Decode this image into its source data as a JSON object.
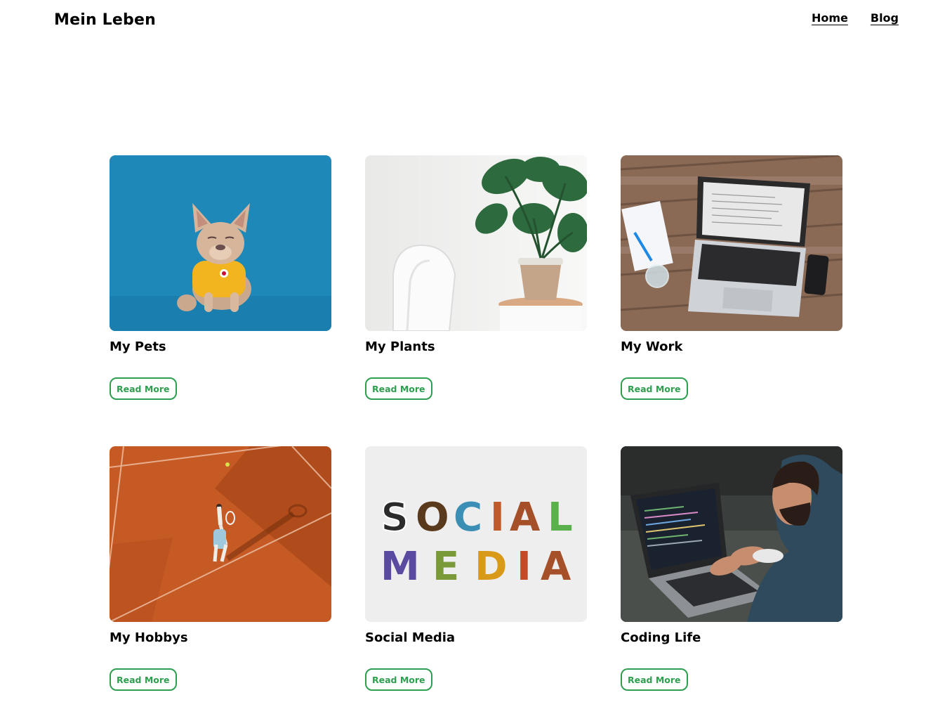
{
  "header": {
    "brand": "Mein Leben",
    "nav": [
      {
        "label": "Home"
      },
      {
        "label": "Blog"
      }
    ]
  },
  "cards": [
    {
      "title": "My Pets",
      "button": "Read More",
      "image": "french-bulldog-photo"
    },
    {
      "title": "My Plants",
      "button": "Read More",
      "image": "monstera-plant-photo"
    },
    {
      "title": "My Work",
      "button": "Read More",
      "image": "laptop-desk-photo"
    },
    {
      "title": "My Hobbys",
      "button": "Read More",
      "image": "tennis-court-photo"
    },
    {
      "title": "Social Media",
      "button": "Read More",
      "image": "social-media-letters-photo"
    },
    {
      "title": "Coding Life",
      "button": "Read More",
      "image": "man-coding-laptop-photo"
    }
  ],
  "colors": {
    "accent": "#2e9e4f",
    "text": "#000000",
    "background": "#ffffff"
  }
}
